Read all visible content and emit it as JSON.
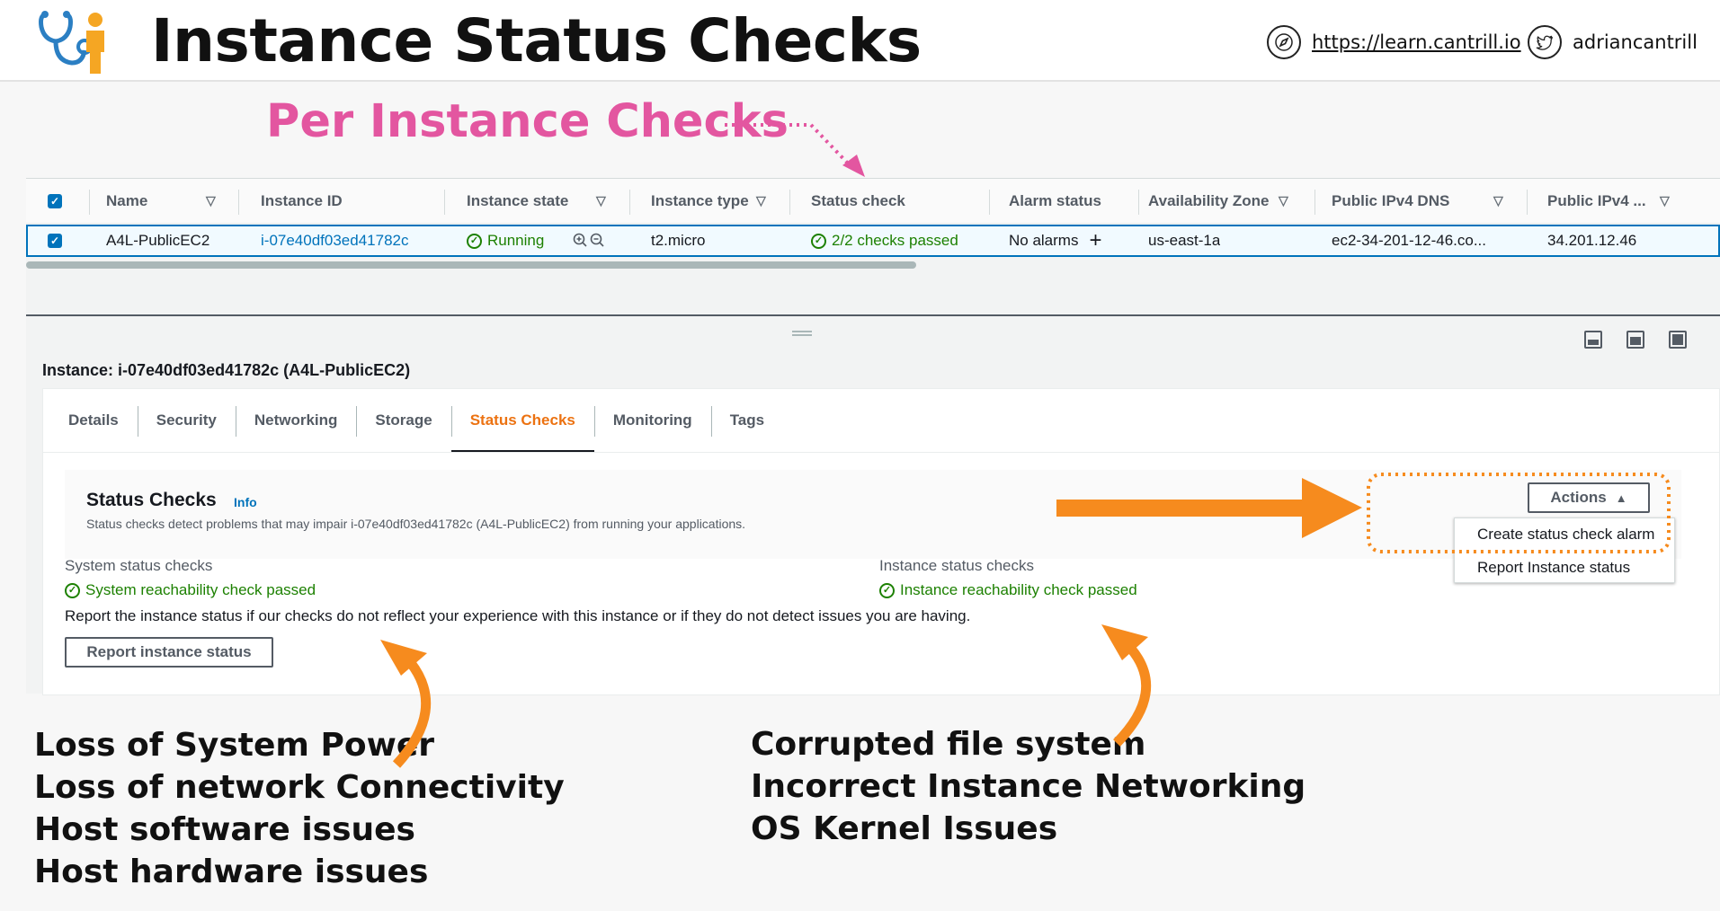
{
  "slide": {
    "title": "Instance Status Checks",
    "website": "https://learn.cantrill.io",
    "twitter": "adriancantrill",
    "annotation": "Per Instance Checks"
  },
  "colors": {
    "annotation_pink": "#e356a0",
    "arrow_orange": "#f68b1e",
    "aws_link": "#0073bb",
    "aws_green": "#1d8102",
    "tab_active": "#ec7211"
  },
  "table": {
    "columns": [
      "Name",
      "Instance ID",
      "Instance state",
      "Instance type",
      "Status check",
      "Alarm status",
      "Availability Zone",
      "Public IPv4 DNS",
      "Public IPv4 ..."
    ],
    "row": {
      "name": "A4L-PublicEC2",
      "instance_id": "i-07e40df03ed41782c",
      "instance_state": "Running",
      "instance_type": "t2.micro",
      "status_check": "2/2 checks passed",
      "alarm_status": "No alarms",
      "availability_zone": "us-east-1a",
      "public_dns": "ec2-34-201-12-46.co...",
      "public_ip": "34.201.12.46"
    }
  },
  "details": {
    "instance_title": "Instance: i-07e40df03ed41782c (A4L-PublicEC2)",
    "tabs": [
      "Details",
      "Security",
      "Networking",
      "Storage",
      "Status Checks",
      "Monitoring",
      "Tags"
    ],
    "active_tab": "Status Checks",
    "status_checks": {
      "heading": "Status Checks",
      "info": "Info",
      "description": "Status checks detect problems that may impair i-07e40df03ed41782c (A4L-PublicEC2) from running your applications.",
      "system_label": "System status checks",
      "system_value": "System reachability check passed",
      "instance_label": "Instance status checks",
      "instance_value": "Instance reachability check passed",
      "report_text": "Report the instance status if our checks do not reflect your experience with this instance or if they do not detect issues you are having.",
      "report_button": "Report instance status"
    },
    "actions": {
      "label": "Actions",
      "menu": [
        "Create status check alarm",
        "Report Instance status"
      ]
    }
  },
  "system_issues": [
    "Loss of System Power",
    "Loss of network Connectivity",
    "Host software issues",
    "Host hardware issues"
  ],
  "instance_issues": [
    "Corrupted file system",
    "Incorrect Instance Networking",
    "OS Kernel Issues"
  ]
}
